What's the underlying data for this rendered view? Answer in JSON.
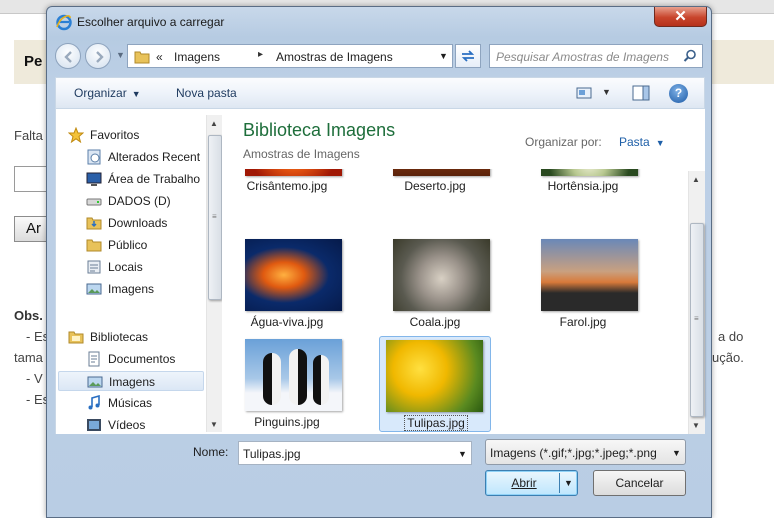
{
  "background_page": {
    "heading_fragment": "Pe",
    "text_fragment_1": "Falta",
    "button_fragment": "Ar",
    "obs_label": "Obs.",
    "line_fragments": [
      "- Es",
      "tama",
      "- V",
      "- Es"
    ],
    "right_fragments": [
      "a do",
      "ução."
    ]
  },
  "dialog": {
    "title": "Escolher arquivo a carregar",
    "close_symbol": "✕",
    "address": {
      "overflow": "«",
      "segments": [
        "Imagens",
        "Amostras de Imagens"
      ],
      "separator": "▸"
    },
    "search_placeholder": "Pesquisar Amostras de Imagens",
    "toolbar": {
      "organize": "Organizar",
      "new_folder": "Nova pasta",
      "help": "?"
    },
    "nav": {
      "favorites_label": "Favoritos",
      "favorites": [
        "Alterados Recent",
        "Área de Trabalho",
        "DADOS (D)",
        "Downloads",
        "Público",
        "Locais",
        "Imagens"
      ],
      "libraries_label": "Bibliotecas",
      "libraries": [
        "Documentos",
        "Imagens",
        "Músicas",
        "Vídeos"
      ],
      "selected_library": "Imagens"
    },
    "content": {
      "library_title": "Biblioteca Imagens",
      "library_subtitle": "Amostras de Imagens",
      "arrange_label": "Organizar por:",
      "arrange_value": "Pasta",
      "files": [
        "Crisântemo.jpg",
        "Deserto.jpg",
        "Hortênsia.jpg",
        "Água-viva.jpg",
        "Coala.jpg",
        "Farol.jpg",
        "Pinguins.jpg",
        "Tulipas.jpg"
      ],
      "selected_file": "Tulipas.jpg"
    },
    "footer": {
      "name_label": "Nome:",
      "name_value": "Tulipas.jpg",
      "filter_value": "Imagens (*.gif;*.jpg;*.jpeg;*.png",
      "open_label": "Abrir",
      "cancel_label": "Cancelar"
    }
  },
  "colors": {
    "accent_green": "#1e6e3b",
    "link_blue": "#1e5fa8",
    "selection": "#d8e9fb"
  }
}
